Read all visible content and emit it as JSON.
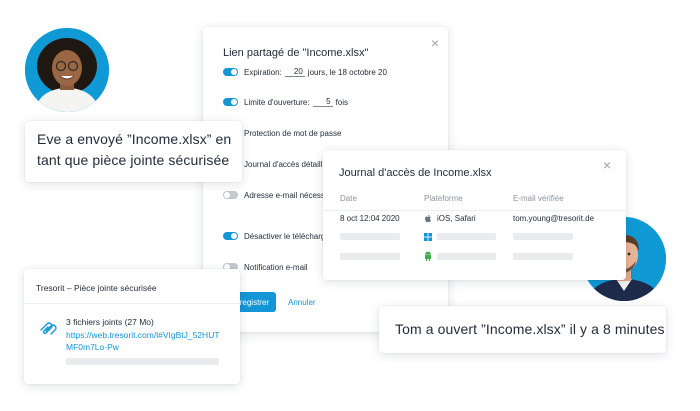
{
  "share_dialog": {
    "title": "Lien partagé de \"Income.xlsx\"",
    "close_glyph": "×",
    "expiration": {
      "label": "Expiration:",
      "value": "20",
      "suffix": "jours, le 18 octobre 20",
      "enabled": true
    },
    "open_limit": {
      "label": "Limite d'ouverture:",
      "value": "5",
      "suffix": "fois",
      "enabled": true
    },
    "password": {
      "label": "Protection de mot de passe"
    },
    "access_log": {
      "label": "Journal d'accès détaillé"
    },
    "email_required": {
      "label": "Adresse e-mail nécessair",
      "enabled": false
    },
    "disable_download": {
      "label": "Désactiver le télécharger",
      "enabled": true
    },
    "email_notification": {
      "label": "Notification e-mail",
      "enabled": false
    },
    "save_label": "Enregistrer",
    "cancel_label": "Annuler"
  },
  "eve_bubble": {
    "text": "Eve a envoyé ”Income.xlsx” en tant que pièce jointe sécurisée"
  },
  "tom_bubble": {
    "text": "Tom a ouvert ”Income.xlsx” il y a 8 minutes"
  },
  "access_journal": {
    "title": "Journal d'accès de Income.xlsx",
    "close_glyph": "×",
    "columns": [
      "Date",
      "Plateforme",
      "E-mail vérifiée"
    ],
    "row": {
      "date": "8 oct 12:04 2020",
      "platform": "iOS, Safari",
      "email": "tom.young@tresorit.de"
    }
  },
  "attachment_card": {
    "title": "Tresorit – Pièce jointe sécurisée",
    "files": "3 fichiers joints (27 Mo)",
    "link": "https://web.tresorit.com/l#VIgBtJ_52HUTMF0m7Lo-Pw"
  },
  "icons": {
    "apple": "apple-icon",
    "windows": "windows-icon",
    "android": "android-icon",
    "paperclip": "paperclip-icon"
  },
  "colors": {
    "accent": "#1296d6",
    "avatar_bg": "#0f9ad6"
  }
}
